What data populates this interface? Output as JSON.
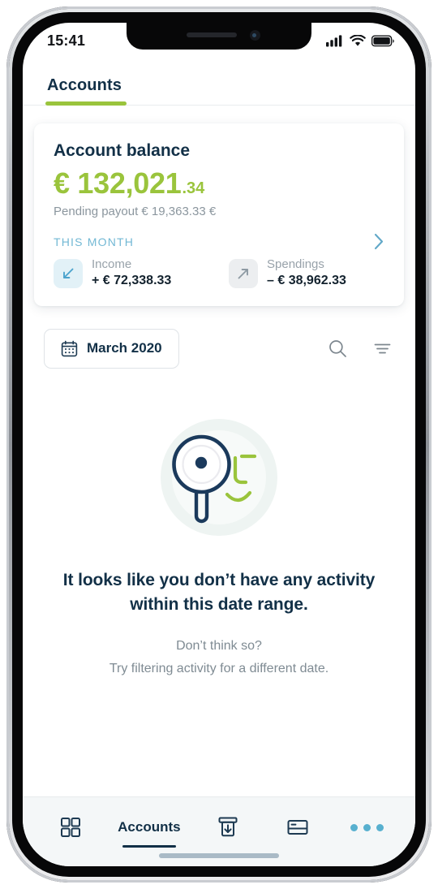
{
  "status_bar": {
    "time": "15:41",
    "icons": [
      "cellular-signal-icon",
      "wifi-icon",
      "battery-icon"
    ]
  },
  "top_tabs": [
    {
      "label": "Accounts",
      "active": true
    }
  ],
  "balance_card": {
    "title": "Account balance",
    "currency_symbol": "€",
    "amount_main": "€ 132,021",
    "amount_cents": ".34",
    "pending_label": "Pending payout € 19,363.33 €",
    "period_label": "THIS MONTH",
    "period_chevron": "chevron-right-icon",
    "stats": [
      {
        "name": "Income",
        "value": "+ € 72,338.33",
        "icon": "arrow-down-left-icon",
        "icon_color": "#4ba3cd",
        "icon_bg": "#e2f1f7"
      },
      {
        "name": "Spendings",
        "value": "– € 38,962.33",
        "icon": "arrow-up-right-icon",
        "icon_color": "#8e9aa3",
        "icon_bg": "#eceef0"
      }
    ]
  },
  "filter_bar": {
    "date_label": "March 2020",
    "calendar_icon": "calendar-icon",
    "search_icon": "search-icon",
    "filter_icon": "filter-icon"
  },
  "empty_state": {
    "illustration": "magnifying-glass-face-illustration",
    "title": "It looks like you don’t have any activity within this date range.",
    "subtitle_line1": "Don’t think so?",
    "subtitle_line2": "Try filtering activity for a different date."
  },
  "bottom_nav": {
    "items": [
      {
        "label": "",
        "icon": "grid-dashboard-icon",
        "active": false
      },
      {
        "label": "Accounts",
        "icon": "",
        "active": true
      },
      {
        "label": "",
        "icon": "deposit-arrow-down-icon",
        "active": false
      },
      {
        "label": "",
        "icon": "payment-card-icon",
        "active": false
      },
      {
        "label": "",
        "icon": "more-dots-icon",
        "active": false
      }
    ]
  },
  "colors": {
    "brand_green": "#9ac43c",
    "navy": "#123047",
    "accent_blue": "#57b0cf",
    "muted": "#8b969e"
  }
}
